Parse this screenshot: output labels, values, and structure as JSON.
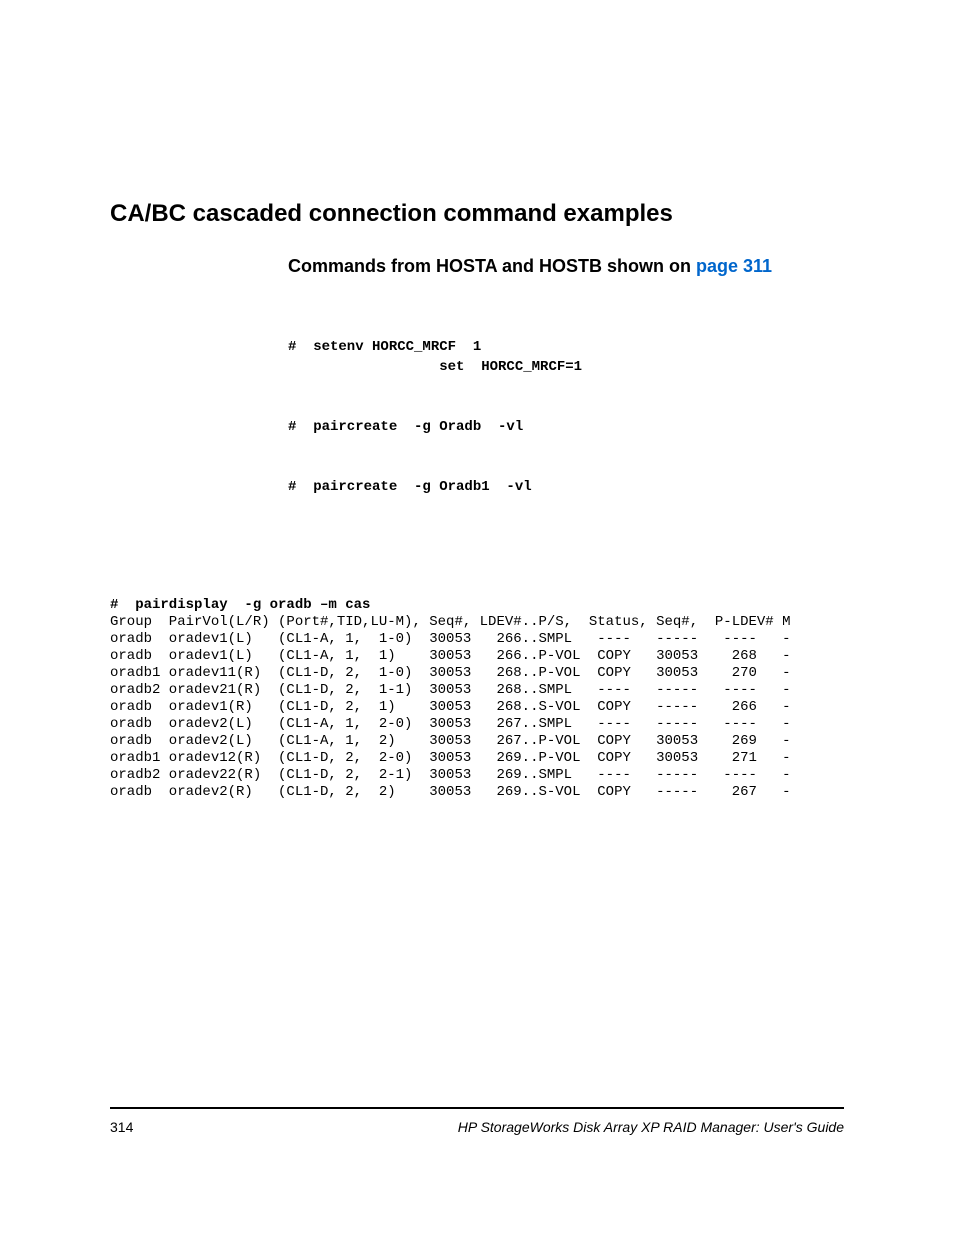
{
  "heading": "CA/BC cascaded connection command examples",
  "subheading_prefix": "Commands from HOSTA and HOSTB shown on ",
  "subheading_link": "page 311",
  "cmd1_line1": "#  setenv HORCC_MRCF  1",
  "cmd1_line2": "                  set  HORCC_MRCF=1",
  "cmd2": "#  paircreate  -g Oradb  -vl",
  "cmd3": "#  paircreate  -g Oradb1  -vl",
  "table_cmd": "#  pairdisplay  -g oradb –m cas",
  "table_header": "Group  PairVol(L/R) (Port#,TID,LU-M), Seq#, LDEV#..P/S,  Status, Seq#,  P-LDEV# M",
  "table_rows": [
    "oradb  oradev1(L)   (CL1-A, 1,  1-0)  30053   266..SMPL   ----   -----   ----   -",
    "oradb  oradev1(L)   (CL1-A, 1,  1)    30053   266..P-VOL  COPY   30053    268   -",
    "oradb1 oradev11(R)  (CL1-D, 2,  1-0)  30053   268..P-VOL  COPY   30053    270   -",
    "oradb2 oradev21(R)  (CL1-D, 2,  1-1)  30053   268..SMPL   ----   -----   ----   -",
    "oradb  oradev1(R)   (CL1-D, 2,  1)    30053   268..S-VOL  COPY   -----    266   -",
    "oradb  oradev2(L)   (CL1-A, 1,  2-0)  30053   267..SMPL   ----   -----   ----   -",
    "oradb  oradev2(L)   (CL1-A, 1,  2)    30053   267..P-VOL  COPY   30053    269   -",
    "oradb1 oradev12(R)  (CL1-D, 2,  2-0)  30053   269..P-VOL  COPY   30053    271   -",
    "oradb2 oradev22(R)  (CL1-D, 2,  2-1)  30053   269..SMPL   ----   -----   ----   -",
    "oradb  oradev2(R)   (CL1-D, 2,  2)    30053   269..S-VOL  COPY   -----    267   -"
  ],
  "page_number": "314",
  "footer_title": "HP StorageWorks Disk Array XP RAID Manager: User's Guide"
}
